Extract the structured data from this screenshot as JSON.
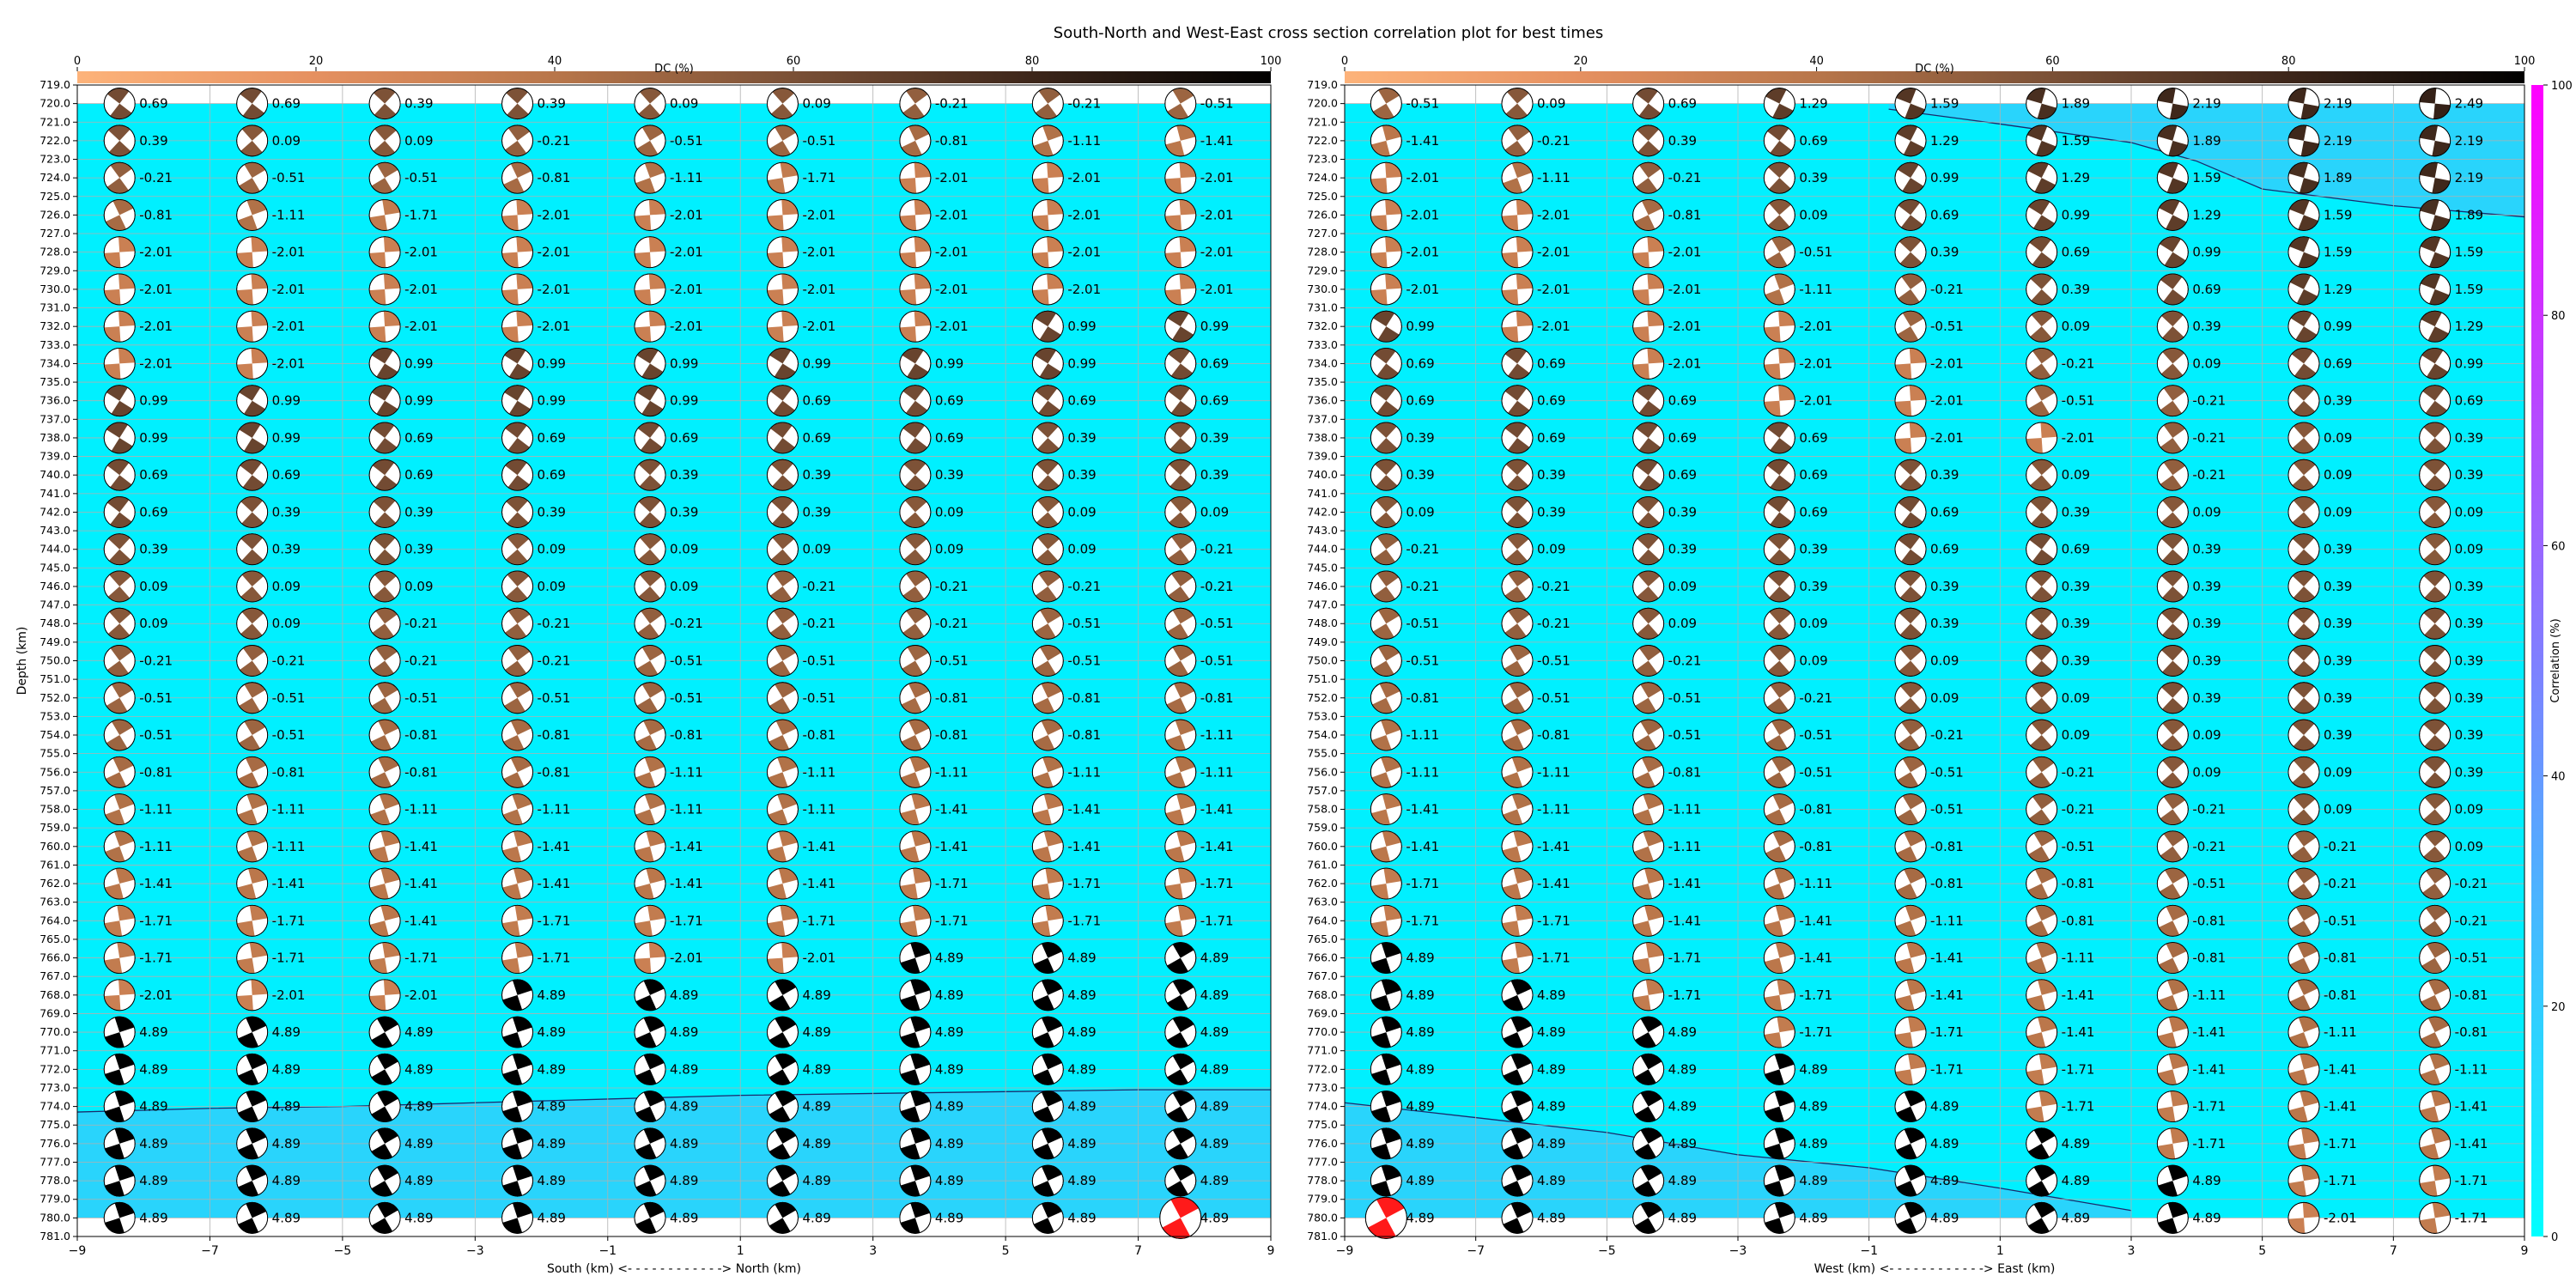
{
  "chart_data": {
    "type": "heatmap",
    "title": "South-North and West-East cross section correlation plot for best times",
    "ylabel": "Depth (km)",
    "depth_range": [
      719.0,
      781.0
    ],
    "depth_ticks": [
      719.0,
      720.0,
      721.0,
      722.0,
      723.0,
      724.0,
      725.0,
      726.0,
      727.0,
      728.0,
      729.0,
      730.0,
      731.0,
      732.0,
      733.0,
      734.0,
      735.0,
      736.0,
      737.0,
      738.0,
      739.0,
      740.0,
      741.0,
      742.0,
      743.0,
      744.0,
      745.0,
      746.0,
      747.0,
      748.0,
      749.0,
      750.0,
      751.0,
      752.0,
      753.0,
      754.0,
      755.0,
      756.0,
      757.0,
      758.0,
      759.0,
      760.0,
      761.0,
      762.0,
      763.0,
      764.0,
      765.0,
      766.0,
      767.0,
      768.0,
      769.0,
      770.0,
      771.0,
      772.0,
      773.0,
      774.0,
      775.0,
      776.0,
      777.0,
      778.0,
      779.0,
      780.0,
      781.0
    ],
    "x_range": [
      -9,
      9
    ],
    "x_ticks": [
      -9,
      -7,
      -5,
      -3,
      -1,
      1,
      3,
      5,
      7,
      9
    ],
    "dc_colorbar": {
      "label": "DC (%)",
      "range": [
        0,
        100
      ],
      "ticks": [
        0,
        20,
        40,
        60,
        80,
        100
      ]
    },
    "correlation_colorbar": {
      "label": "Correlation (%)",
      "range": [
        0,
        100
      ],
      "ticks": [
        0,
        20,
        40,
        60,
        80,
        100
      ]
    },
    "colors": {
      "cyan_field": "#00f0ff",
      "light_blue_field": "#29d4fc",
      "best_beachball": "#ff1a1a",
      "correlation_top": "#ff00ff"
    },
    "panels": [
      {
        "name": "south-north",
        "xlabel": "South (km) <- - - - - - - - - - - -> North (km)",
        "columns_x": [
          -8,
          -6,
          -4,
          -2,
          0,
          2,
          4,
          6,
          8
        ],
        "boundary": [
          [
            -9,
            774.3
          ],
          [
            -7,
            774.1
          ],
          [
            -5,
            774.0
          ],
          [
            -3,
            773.8
          ],
          [
            -1,
            773.6
          ],
          [
            1,
            773.4
          ],
          [
            3,
            773.3
          ],
          [
            5,
            773.2
          ],
          [
            7,
            773.1
          ],
          [
            9,
            773.1
          ]
        ],
        "best_cell": {
          "x": 8,
          "depth": 780.0
        },
        "time_labels": [
          [
            "0.69",
            "0.69",
            "0.39",
            "0.39",
            "0.09",
            "0.09",
            "-0.21",
            "-0.21",
            "-0.51"
          ],
          [
            "0.39",
            "0.09",
            "0.09",
            "-0.21",
            "-0.51",
            "-0.51",
            "-0.81",
            "-1.11",
            "-1.41"
          ],
          [
            "-0.21",
            "-0.51",
            "-0.51",
            "-0.81",
            "-1.11",
            "-1.71",
            "-2.01",
            "-2.01",
            "-2.01"
          ],
          [
            "-0.81",
            "-1.11",
            "-1.71",
            "-2.01",
            "-2.01",
            "-2.01",
            "-2.01",
            "-2.01",
            "-2.01"
          ],
          [
            "-2.01",
            "-2.01",
            "-2.01",
            "-2.01",
            "-2.01",
            "-2.01",
            "-2.01",
            "-2.01",
            "-2.01"
          ],
          [
            "-2.01",
            "-2.01",
            "-2.01",
            "-2.01",
            "-2.01",
            "-2.01",
            "-2.01",
            "-2.01",
            "-2.01"
          ],
          [
            "-2.01",
            "-2.01",
            "-2.01",
            "-2.01",
            "-2.01",
            "-2.01",
            "-2.01",
            "0.99",
            "0.99"
          ],
          [
            "-2.01",
            "-2.01",
            "0.99",
            "0.99",
            "0.99",
            "0.99",
            "0.99",
            "0.99",
            "0.69"
          ],
          [
            "0.99",
            "0.99",
            "0.99",
            "0.99",
            "0.99",
            "0.69",
            "0.69",
            "0.69",
            "0.69"
          ],
          [
            "0.99",
            "0.99",
            "0.69",
            "0.69",
            "0.69",
            "0.69",
            "0.69",
            "0.39",
            "0.39"
          ],
          [
            "0.69",
            "0.69",
            "0.69",
            "0.69",
            "0.39",
            "0.39",
            "0.39",
            "0.39",
            "0.39"
          ],
          [
            "0.69",
            "0.39",
            "0.39",
            "0.39",
            "0.39",
            "0.39",
            "0.09",
            "0.09",
            "0.09"
          ],
          [
            "0.39",
            "0.39",
            "0.39",
            "0.09",
            "0.09",
            "0.09",
            "0.09",
            "0.09",
            "-0.21"
          ],
          [
            "0.09",
            "0.09",
            "0.09",
            "0.09",
            "0.09",
            "-0.21",
            "-0.21",
            "-0.21",
            "-0.21"
          ],
          [
            "0.09",
            "0.09",
            "-0.21",
            "-0.21",
            "-0.21",
            "-0.21",
            "-0.21",
            "-0.51",
            "-0.51"
          ],
          [
            "-0.21",
            "-0.21",
            "-0.21",
            "-0.21",
            "-0.51",
            "-0.51",
            "-0.51",
            "-0.51",
            "-0.51"
          ],
          [
            "-0.51",
            "-0.51",
            "-0.51",
            "-0.51",
            "-0.51",
            "-0.51",
            "-0.81",
            "-0.81",
            "-0.81"
          ],
          [
            "-0.51",
            "-0.51",
            "-0.81",
            "-0.81",
            "-0.81",
            "-0.81",
            "-0.81",
            "-0.81",
            "-1.11"
          ],
          [
            "-0.81",
            "-0.81",
            "-0.81",
            "-0.81",
            "-1.11",
            "-1.11",
            "-1.11",
            "-1.11",
            "-1.11"
          ],
          [
            "-1.11",
            "-1.11",
            "-1.11",
            "-1.11",
            "-1.11",
            "-1.11",
            "-1.41",
            "-1.41",
            "-1.41"
          ],
          [
            "-1.11",
            "-1.11",
            "-1.41",
            "-1.41",
            "-1.41",
            "-1.41",
            "-1.41",
            "-1.41",
            "-1.41"
          ],
          [
            "-1.41",
            "-1.41",
            "-1.41",
            "-1.41",
            "-1.41",
            "-1.41",
            "-1.71",
            "-1.71",
            "-1.71"
          ],
          [
            "-1.71",
            "-1.71",
            "-1.41",
            "-1.71",
            "-1.71",
            "-1.71",
            "-1.71",
            "-1.71",
            "-1.71"
          ],
          [
            "-1.71",
            "-1.71",
            "-1.71",
            "-1.71",
            "-2.01",
            "-2.01",
            "4.89",
            "4.89",
            "4.89"
          ],
          [
            "-2.01",
            "-2.01",
            "-2.01",
            "4.89",
            "4.89",
            "4.89",
            "4.89",
            "4.89",
            "4.89"
          ],
          [
            "4.89",
            "4.89",
            "4.89",
            "4.89",
            "4.89",
            "4.89",
            "4.89",
            "4.89",
            "4.89"
          ],
          [
            "4.89",
            "4.89",
            "4.89",
            "4.89",
            "4.89",
            "4.89",
            "4.89",
            "4.89",
            "4.89"
          ],
          [
            "4.89",
            "4.89",
            "4.89",
            "4.89",
            "4.89",
            "4.89",
            "4.89",
            "4.89",
            "4.89"
          ],
          [
            "4.89",
            "4.89",
            "4.89",
            "4.89",
            "4.89",
            "4.89",
            "4.89",
            "4.89",
            "4.89"
          ],
          [
            "4.89",
            "4.89",
            "4.89",
            "4.89",
            "4.89",
            "4.89",
            "4.89",
            "4.89",
            "4.89"
          ],
          [
            "4.89",
            "4.89",
            "4.89",
            "4.89",
            "4.89",
            "4.89",
            "4.89",
            "4.89",
            "4.89"
          ]
        ]
      },
      {
        "name": "west-east",
        "xlabel": "West (km) <- - - - - - - - - - - -> East (km)",
        "columns_x": [
          -8,
          -6,
          -4,
          -2,
          0,
          2,
          4,
          6,
          8
        ],
        "boundary_upper": [
          [
            -0.7,
            720.3
          ],
          [
            1,
            721.1
          ],
          [
            3,
            722.1
          ],
          [
            4,
            723.1
          ],
          [
            5,
            724.6
          ],
          [
            7,
            725.5
          ],
          [
            9,
            726.1
          ]
        ],
        "boundary_lower": [
          [
            -9,
            773.8
          ],
          [
            -7,
            774.6
          ],
          [
            -5,
            775.4
          ],
          [
            -3,
            776.6
          ],
          [
            -1,
            777.3
          ],
          [
            1,
            778.4
          ],
          [
            3,
            779.6
          ]
        ],
        "best_cell": {
          "x": -8,
          "depth": 780.0
        },
        "time_labels": [
          [
            "-0.51",
            "0.09",
            "0.69",
            "1.29",
            "1.59",
            "1.89",
            "2.19",
            "2.19",
            "2.49"
          ],
          [
            "-1.41",
            "-0.21",
            "0.39",
            "0.69",
            "1.29",
            "1.59",
            "1.89",
            "2.19",
            "2.19"
          ],
          [
            "-2.01",
            "-1.11",
            "-0.21",
            "0.39",
            "0.99",
            "1.29",
            "1.59",
            "1.89",
            "2.19"
          ],
          [
            "-2.01",
            "-2.01",
            "-0.81",
            "0.09",
            "0.69",
            "0.99",
            "1.29",
            "1.59",
            "1.89"
          ],
          [
            "-2.01",
            "-2.01",
            "-2.01",
            "-0.51",
            "0.39",
            "0.69",
            "0.99",
            "1.59",
            "1.59"
          ],
          [
            "-2.01",
            "-2.01",
            "-2.01",
            "-1.11",
            "-0.21",
            "0.39",
            "0.69",
            "1.29",
            "1.59"
          ],
          [
            "0.99",
            "-2.01",
            "-2.01",
            "-2.01",
            "-0.51",
            "0.09",
            "0.39",
            "0.99",
            "1.29"
          ],
          [
            "0.69",
            "0.69",
            "-2.01",
            "-2.01",
            "-2.01",
            "-0.21",
            "0.09",
            "0.69",
            "0.99"
          ],
          [
            "0.69",
            "0.69",
            "0.69",
            "-2.01",
            "-2.01",
            "-0.51",
            "-0.21",
            "0.39",
            "0.69"
          ],
          [
            "0.39",
            "0.69",
            "0.69",
            "0.69",
            "-2.01",
            "-2.01",
            "-0.21",
            "0.09",
            "0.39"
          ],
          [
            "0.39",
            "0.39",
            "0.69",
            "0.69",
            "0.39",
            "0.09",
            "-0.21",
            "0.09",
            "0.39"
          ],
          [
            "0.09",
            "0.39",
            "0.39",
            "0.69",
            "0.69",
            "0.39",
            "0.09",
            "0.09",
            "0.09"
          ],
          [
            "-0.21",
            "0.09",
            "0.39",
            "0.39",
            "0.69",
            "0.69",
            "0.39",
            "0.39",
            "0.09"
          ],
          [
            "-0.21",
            "-0.21",
            "0.09",
            "0.39",
            "0.39",
            "0.39",
            "0.39",
            "0.39",
            "0.39"
          ],
          [
            "-0.51",
            "-0.21",
            "0.09",
            "0.09",
            "0.39",
            "0.39",
            "0.39",
            "0.39",
            "0.39"
          ],
          [
            "-0.51",
            "-0.51",
            "-0.21",
            "0.09",
            "0.09",
            "0.39",
            "0.39",
            "0.39",
            "0.39"
          ],
          [
            "-0.81",
            "-0.51",
            "-0.51",
            "-0.21",
            "0.09",
            "0.09",
            "0.39",
            "0.39",
            "0.39"
          ],
          [
            "-1.11",
            "-0.81",
            "-0.51",
            "-0.51",
            "-0.21",
            "0.09",
            "0.09",
            "0.39",
            "0.39"
          ],
          [
            "-1.11",
            "-1.11",
            "-0.81",
            "-0.51",
            "-0.51",
            "-0.21",
            "0.09",
            "0.09",
            "0.39"
          ],
          [
            "-1.41",
            "-1.11",
            "-1.11",
            "-0.81",
            "-0.51",
            "-0.21",
            "-0.21",
            "0.09",
            "0.09"
          ],
          [
            "-1.41",
            "-1.41",
            "-1.11",
            "-0.81",
            "-0.81",
            "-0.51",
            "-0.21",
            "-0.21",
            "0.09"
          ],
          [
            "-1.71",
            "-1.41",
            "-1.41",
            "-1.11",
            "-0.81",
            "-0.81",
            "-0.51",
            "-0.21",
            "-0.21"
          ],
          [
            "-1.71",
            "-1.71",
            "-1.41",
            "-1.41",
            "-1.11",
            "-0.81",
            "-0.81",
            "-0.51",
            "-0.21"
          ],
          [
            "4.89",
            "-1.71",
            "-1.71",
            "-1.41",
            "-1.41",
            "-1.11",
            "-0.81",
            "-0.81",
            "-0.51"
          ],
          [
            "4.89",
            "4.89",
            "-1.71",
            "-1.71",
            "-1.41",
            "-1.41",
            "-1.11",
            "-0.81",
            "-0.81"
          ],
          [
            "4.89",
            "4.89",
            "4.89",
            "-1.71",
            "-1.71",
            "-1.41",
            "-1.41",
            "-1.11",
            "-0.81"
          ],
          [
            "4.89",
            "4.89",
            "4.89",
            "4.89",
            "-1.71",
            "-1.71",
            "-1.41",
            "-1.41",
            "-1.11"
          ],
          [
            "4.89",
            "4.89",
            "4.89",
            "4.89",
            "4.89",
            "-1.71",
            "-1.71",
            "-1.41",
            "-1.41"
          ],
          [
            "4.89",
            "4.89",
            "4.89",
            "4.89",
            "4.89",
            "4.89",
            "-1.71",
            "-1.71",
            "-1.41"
          ],
          [
            "4.89",
            "4.89",
            "4.89",
            "4.89",
            "4.89",
            "4.89",
            "4.89",
            "-1.71",
            "-1.71"
          ],
          [
            "4.89",
            "4.89",
            "4.89",
            "4.89",
            "4.89",
            "4.89",
            "4.89",
            "-2.01",
            "-1.71"
          ]
        ]
      }
    ]
  }
}
